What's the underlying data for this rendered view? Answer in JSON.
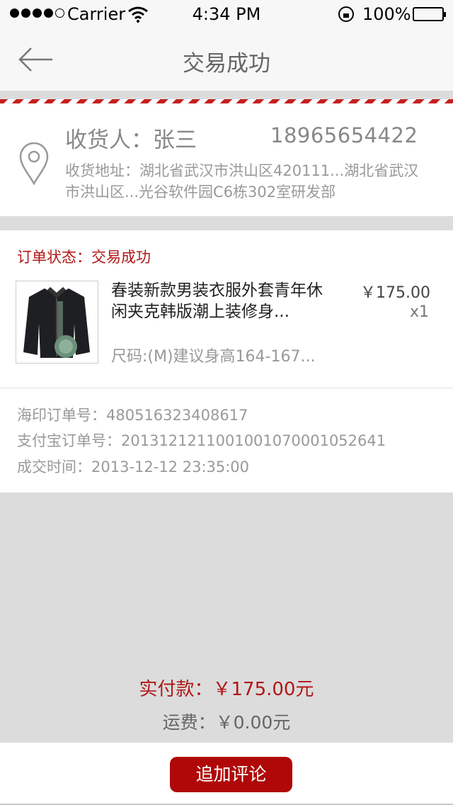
{
  "status_bar": {
    "carrier": "Carrier",
    "time": "4:34 PM",
    "battery_pct": "100%"
  },
  "nav": {
    "title": "交易成功"
  },
  "address": {
    "receiver": "收货人：张三",
    "phone": "18965654422",
    "address_text": "收货地址：湖北省武汉市洪山区420111...湖北省武汉市洪山区...光谷软件园C6栋302室研发部"
  },
  "order": {
    "status": "订单状态：交易成功",
    "product_name": "春装新款男装衣服外套青年休闲夹克韩版潮上装修身...",
    "price": "￥175.00",
    "quantity": "x1",
    "size": "尺码:(M)建议身高164-167...",
    "meta": [
      "海印订单号：480516323408617",
      "支付宝订单号：2013121211001001070001052641",
      "成交时间：2013-12-12  23:35:00"
    ]
  },
  "summary": {
    "paid": "实付款：￥175.00元",
    "shipping": "运费：￥0.00元"
  },
  "footer": {
    "button_label": "追加评论"
  },
  "colors": {
    "accent": "#b01717",
    "button": "#b00808",
    "background": "#dcdcdc"
  }
}
